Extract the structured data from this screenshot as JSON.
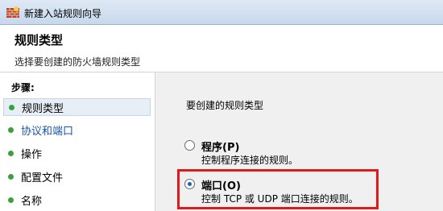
{
  "window": {
    "title": "新建入站规则向导"
  },
  "header": {
    "title": "规则类型",
    "subtitle": "选择要创建的防火墙规则类型"
  },
  "steps": {
    "heading": "步骤:",
    "items": [
      {
        "label": "规则类型"
      },
      {
        "label": "协议和端口"
      },
      {
        "label": "操作"
      },
      {
        "label": "配置文件"
      },
      {
        "label": "名称"
      }
    ]
  },
  "main": {
    "question": "要创建的规则类型",
    "options": [
      {
        "label": "程序(P)",
        "description": "控制程序连接的规则。",
        "selected": false
      },
      {
        "label": "端口(O)",
        "description": "控制 TCP 或 UDP 端口连接的规则。",
        "selected": true
      }
    ]
  },
  "colors": {
    "highlight": "#e0191b",
    "step_bullet": "#3aa23a",
    "link": "#1a55a8"
  }
}
